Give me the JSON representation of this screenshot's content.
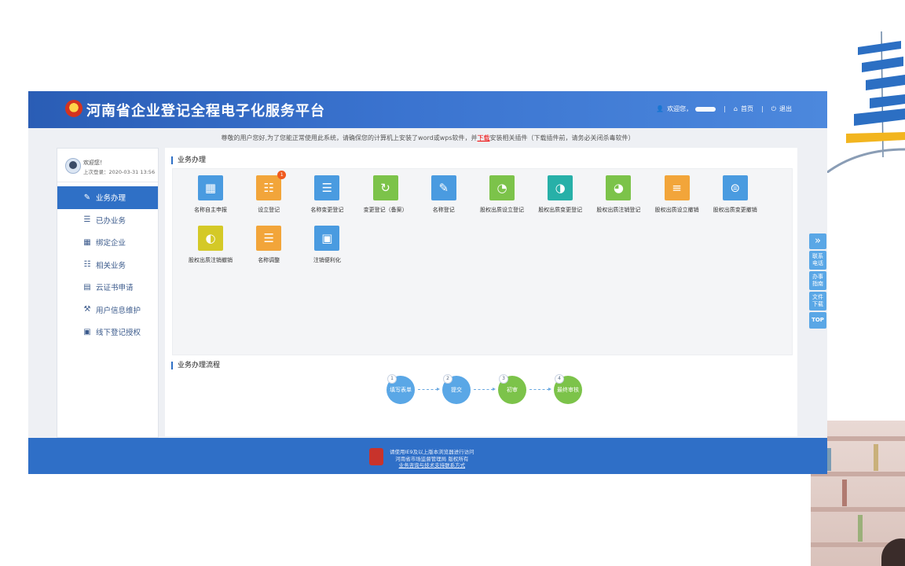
{
  "header": {
    "site_title": "河南省企业登记全程电子化服务平台",
    "welcome_label": "欢迎您，",
    "home_label": "首页",
    "logout_label": "退出"
  },
  "notice": {
    "before": "尊敬的用户您好,为了您能正常使用此系统，请确保您的计算机上安装了word或wps软件，并",
    "link": "下载",
    "after": "安装相关插件（下载插件前，请务必关闭杀毒软件）"
  },
  "sidebar": {
    "welcome": "欢迎您！",
    "last_login": "上次登录：2020-03-31 13:56",
    "items": [
      {
        "label": "业务办理",
        "icon": "edit-icon",
        "active": true
      },
      {
        "label": "已办业务",
        "icon": "document-icon"
      },
      {
        "label": "绑定企业",
        "icon": "building-icon"
      },
      {
        "label": "相关业务",
        "icon": "list-icon"
      },
      {
        "label": "云证书申请",
        "icon": "certificate-icon"
      },
      {
        "label": "用户信息维护",
        "icon": "tools-icon"
      },
      {
        "label": "线下登记授权",
        "icon": "lock-icon"
      }
    ]
  },
  "business": {
    "title": "业务办理",
    "tiles": [
      {
        "label": "名称自主申报",
        "color": "#4a9be0",
        "icon": "building-icon"
      },
      {
        "label": "设立登记",
        "color": "#f2a53a",
        "icon": "clipboard-icon",
        "badge": "1"
      },
      {
        "label": "名称变更登记",
        "color": "#4a9be0",
        "icon": "form-icon"
      },
      {
        "label": "变更登记（备案）",
        "color": "#7cc34a",
        "icon": "clipboard-refresh-icon"
      },
      {
        "label": "名称登记",
        "color": "#4a9be0",
        "icon": "edit-doc-icon"
      },
      {
        "label": "股权出质设立登记",
        "color": "#7cc34a",
        "icon": "pie-chart-icon"
      },
      {
        "label": "股权出质变更登记",
        "color": "#27b0a8",
        "icon": "pie-change-icon"
      },
      {
        "label": "股权出质注销登记",
        "color": "#7cc34a",
        "icon": "pie-cancel-icon"
      },
      {
        "label": "股权出质设立撤销",
        "color": "#f2a53a",
        "icon": "list-revoke-icon"
      },
      {
        "label": "股权出质变更撤销",
        "color": "#4a9be0",
        "icon": "stack-revoke-icon"
      },
      {
        "label": "股权出质注销撤销",
        "color": "#d4c927",
        "icon": "gauge-icon"
      },
      {
        "label": "名称调整",
        "color": "#f2a53a",
        "icon": "adjust-icon"
      },
      {
        "label": "注销便利化",
        "color": "#4a9be0",
        "icon": "screen-icon"
      }
    ]
  },
  "flow": {
    "title": "业务办理流程",
    "steps": [
      {
        "num": "1",
        "label": "填写表单",
        "color": "#5aa7e6"
      },
      {
        "num": "2",
        "label": "提交",
        "color": "#5aa7e6"
      },
      {
        "num": "3",
        "label": "初审",
        "color": "#7cc34a"
      },
      {
        "num": "4",
        "label": "最终审核",
        "color": "#7cc34a"
      }
    ]
  },
  "footer": {
    "line1": "请使用IE9及以上版本浏览器进行访问",
    "line2": "河南省市场监督管理局 版权所有",
    "line3": "业务咨询与技术支持联系方式"
  },
  "side_tools": {
    "expand": "»",
    "contact": [
      "联系",
      "电话"
    ],
    "guide": [
      "办事",
      "指南"
    ],
    "files": [
      "文件",
      "下载"
    ],
    "top": "TOP"
  }
}
